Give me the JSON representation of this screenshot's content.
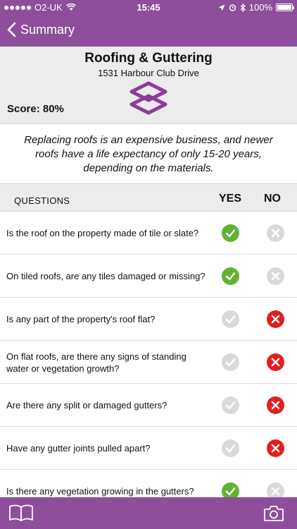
{
  "status": {
    "carrier": "O2-UK",
    "time": "15:45",
    "battery": "100%"
  },
  "nav": {
    "back_label": "Summary"
  },
  "header": {
    "title": "Roofing & Guttering",
    "address": "1531 Harbour Club Drive",
    "score": "Score: 80%"
  },
  "intro": "Replacing roofs is an expensive business, and newer roofs have a life expectancy of only 15-20 years, depending on the materials.",
  "questions_header": {
    "label": "QUESTIONS",
    "yes": "YES",
    "no": "NO"
  },
  "questions": [
    {
      "text": "Is the roof on the property made of tile or slate?",
      "answer": "yes"
    },
    {
      "text": "On tiled roofs, are any tiles damaged or missing?",
      "answer": "yes"
    },
    {
      "text": "Is any part of the property's roof flat?",
      "answer": "no"
    },
    {
      "text": "On flat roofs, are there any signs of standing water or vegetation growth?",
      "answer": "no"
    },
    {
      "text": "Are there any split or damaged gutters?",
      "answer": "no"
    },
    {
      "text": "Have any gutter joints pulled apart?",
      "answer": "no"
    },
    {
      "text": "Is there any vegetation growing in the gutters?",
      "answer": "yes"
    }
  ],
  "icons": {
    "back": "chevron-left-icon",
    "logo": "layers-icon",
    "yes": "check-icon",
    "no": "close-icon",
    "book": "book-icon",
    "camera": "camera-icon"
  },
  "colors": {
    "brand": "#8f4e9c",
    "yes_on": "#62b233",
    "no_on": "#e02020",
    "off": "#dadada"
  }
}
